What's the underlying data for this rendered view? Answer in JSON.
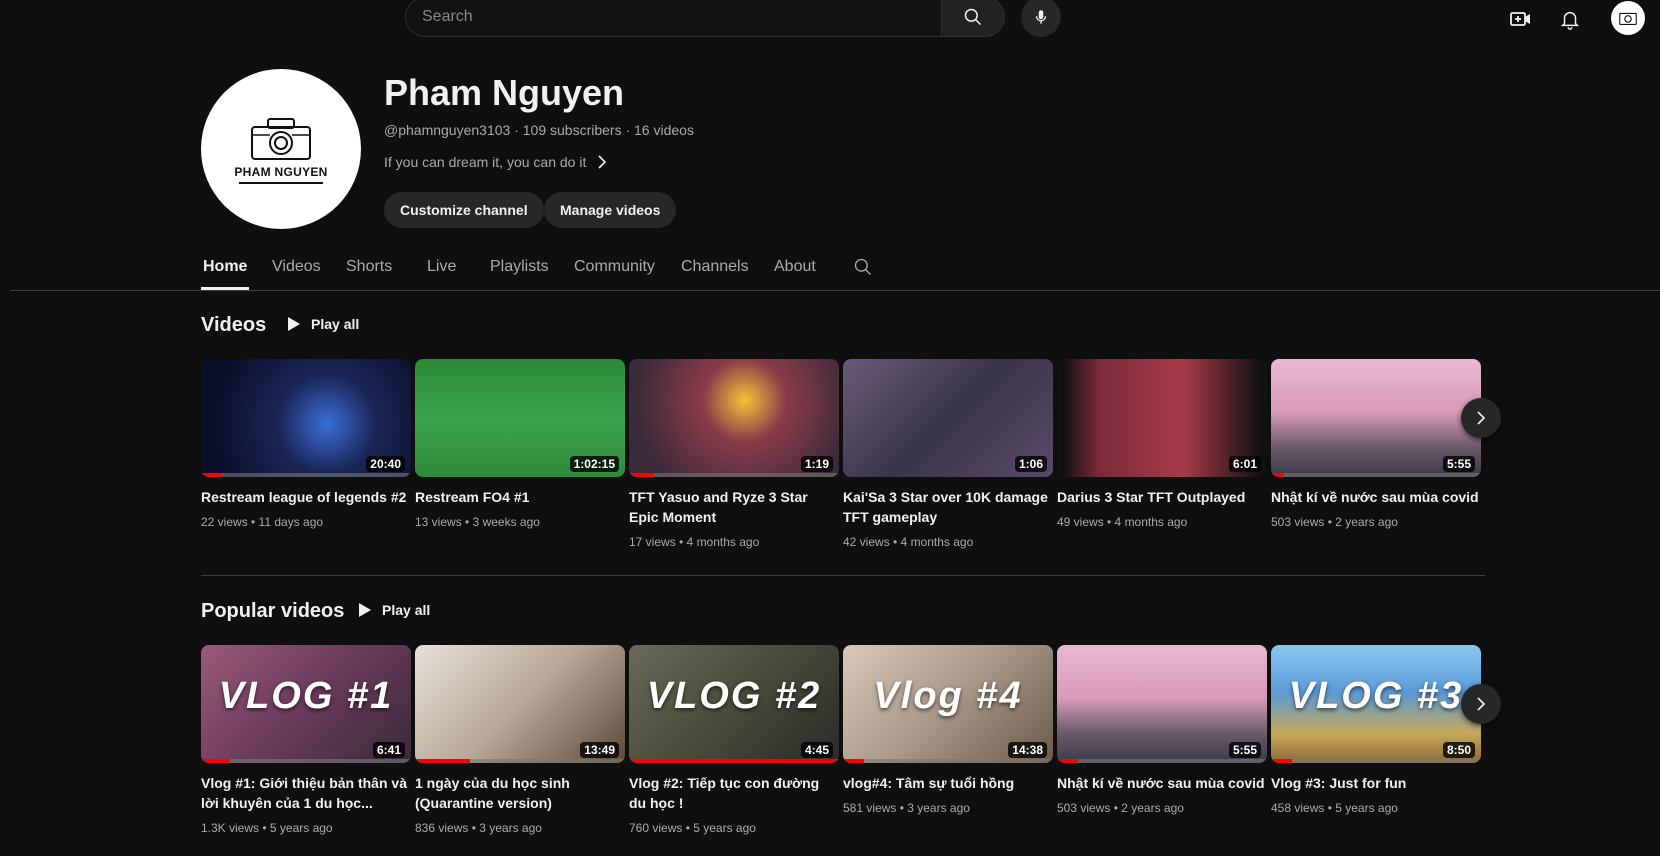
{
  "search": {
    "placeholder": "Search"
  },
  "icons": {
    "search": "search-icon",
    "mic": "mic-icon",
    "create": "create-video-icon",
    "bell": "bell-icon",
    "tabs_search": "search-icon",
    "next": "chevron-right-icon",
    "play": "play-icon"
  },
  "colors": {
    "background": "#0f0f0f",
    "accent": "#ff0000",
    "pill": "#272727",
    "text": "#f1f1f1",
    "muted": "#aaaaaa"
  },
  "channel": {
    "name": "Pham Nguyen",
    "logo_text": "PHAM NGUYEN",
    "meta": "@phamnguyen3103 · 109 subscribers · 16 videos",
    "description": "If you can dream it, you can do it",
    "customize_label": "Customize channel",
    "manage_label": "Manage videos"
  },
  "tabs": [
    {
      "label": "Home",
      "active": true
    },
    {
      "label": "Videos"
    },
    {
      "label": "Shorts"
    },
    {
      "label": "Live"
    },
    {
      "label": "Playlists"
    },
    {
      "label": "Community"
    },
    {
      "label": "Channels"
    },
    {
      "label": "About"
    }
  ],
  "sections": {
    "videos": {
      "title": "Videos",
      "play_all": "Play all",
      "items": [
        {
          "title": "Restream league of legends #2",
          "duration": "20:40",
          "meta": "22 views • 11 days ago",
          "progress": 0.1
        },
        {
          "title": "Restream FO4 #1",
          "duration": "1:02:15",
          "meta": "13 views • 3 weeks ago",
          "progress": 0
        },
        {
          "title": "TFT Yasuo and Ryze 3 Star Epic Moment",
          "duration": "1:19",
          "meta": "17 views • 4 months ago",
          "progress": 0.12
        },
        {
          "title": "Kai'Sa 3 Star over 10K damage TFT gameplay",
          "duration": "1:06",
          "meta": "42 views • 4 months ago",
          "progress": 0
        },
        {
          "title": "Darius 3 Star TFT Outplayed",
          "duration": "6:01",
          "meta": "49 views • 4 months ago",
          "progress": 0
        },
        {
          "title": "Nhật kí về nước sau mùa covid",
          "duration": "5:55",
          "meta": "503 views • 2 years ago",
          "progress": 0.06
        }
      ]
    },
    "popular": {
      "title": "Popular videos",
      "play_all": "Play all",
      "items": [
        {
          "title": "Vlog #1: Giới thiệu bản thân và lời khuyên của 1 du học...",
          "duration": "6:41",
          "meta": "1.3K views • 5 years ago",
          "progress": 0.14,
          "overlay": "VLOG #1"
        },
        {
          "title": "1 ngày của du học sinh (Quarantine version)",
          "duration": "13:49",
          "meta": "836 views • 3 years ago",
          "progress": 0.26,
          "overlay": ""
        },
        {
          "title": "Vlog #2: Tiếp tục con đường du học !",
          "duration": "4:45",
          "meta": "760 views • 5 years ago",
          "progress": 1.0,
          "overlay": "VLOG #2"
        },
        {
          "title": "vlog#4: Tâm sự tuổi hồng",
          "duration": "14:38",
          "meta": "581 views • 3 years ago",
          "progress": 0.1,
          "overlay": "Vlog #4"
        },
        {
          "title": "Nhật kí về nước sau mùa covid",
          "duration": "5:55",
          "meta": "503 views • 2 years ago",
          "progress": 0.1,
          "overlay": ""
        },
        {
          "title": "Vlog #3: Just for fun",
          "duration": "8:50",
          "meta": "458 views • 5 years ago",
          "progress": 0.1,
          "overlay": "VLOG #3"
        }
      ]
    }
  }
}
